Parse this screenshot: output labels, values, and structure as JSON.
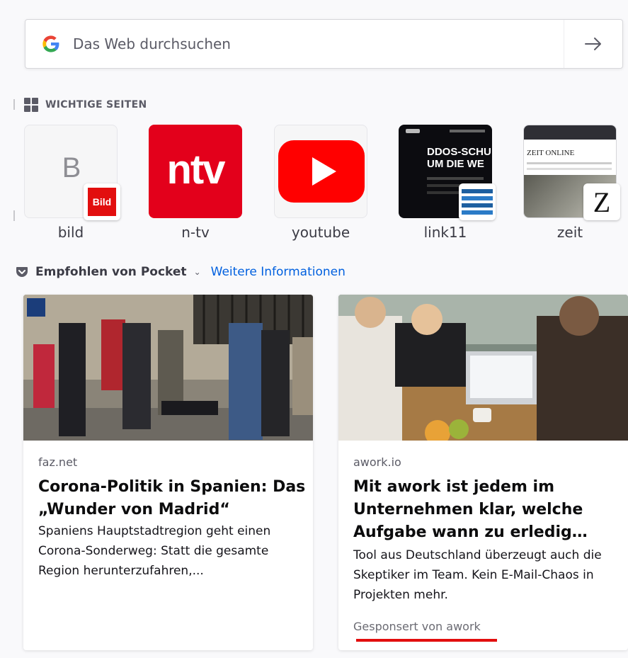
{
  "search": {
    "placeholder": "Das Web durchsuchen",
    "engine_icon": "google-icon",
    "go_icon": "arrow-right-icon"
  },
  "top_sites": {
    "header": "WICHTIGE SEITEN",
    "icon": "grid-icon",
    "tiles": [
      {
        "label": "bild",
        "letter": "B",
        "badge_text": "Bild",
        "badge_color": "#e20e0e"
      },
      {
        "label": "n-tv",
        "logo_text": "ntv",
        "bg": "#e3001b"
      },
      {
        "label": "youtube",
        "logo": "youtube-play-icon",
        "color": "#ff0000"
      },
      {
        "label": "link11",
        "thumb_text": "DDOS-SCHU\nUM DIE WE"
      },
      {
        "label": "zeit",
        "masthead": "ZEIT ONLINE",
        "badge_text": "Z"
      }
    ]
  },
  "pocket": {
    "title": "Empfohlen von Pocket",
    "link": "Weitere Informationen",
    "icon": "pocket-icon"
  },
  "stories": [
    {
      "source": "faz.net",
      "headline": "Corona-Politik in Spanien: Das „Wunder von Madrid“",
      "excerpt": "Spaniens Hauptstadtregion geht einen Corona-Sonderweg: Statt die gesamte Region herunterzufahren,..."
    },
    {
      "source": "awork.io",
      "headline": "Mit awork ist jedem im Unternehmen klar, welche Aufgabe wann zu erledig…",
      "excerpt": "Tool aus Deutschland überzeugt auch die Skeptiker im Team. Kein E-Mail-Chaos in Projekten mehr.",
      "sponsored": "Gesponsert von awork"
    }
  ]
}
